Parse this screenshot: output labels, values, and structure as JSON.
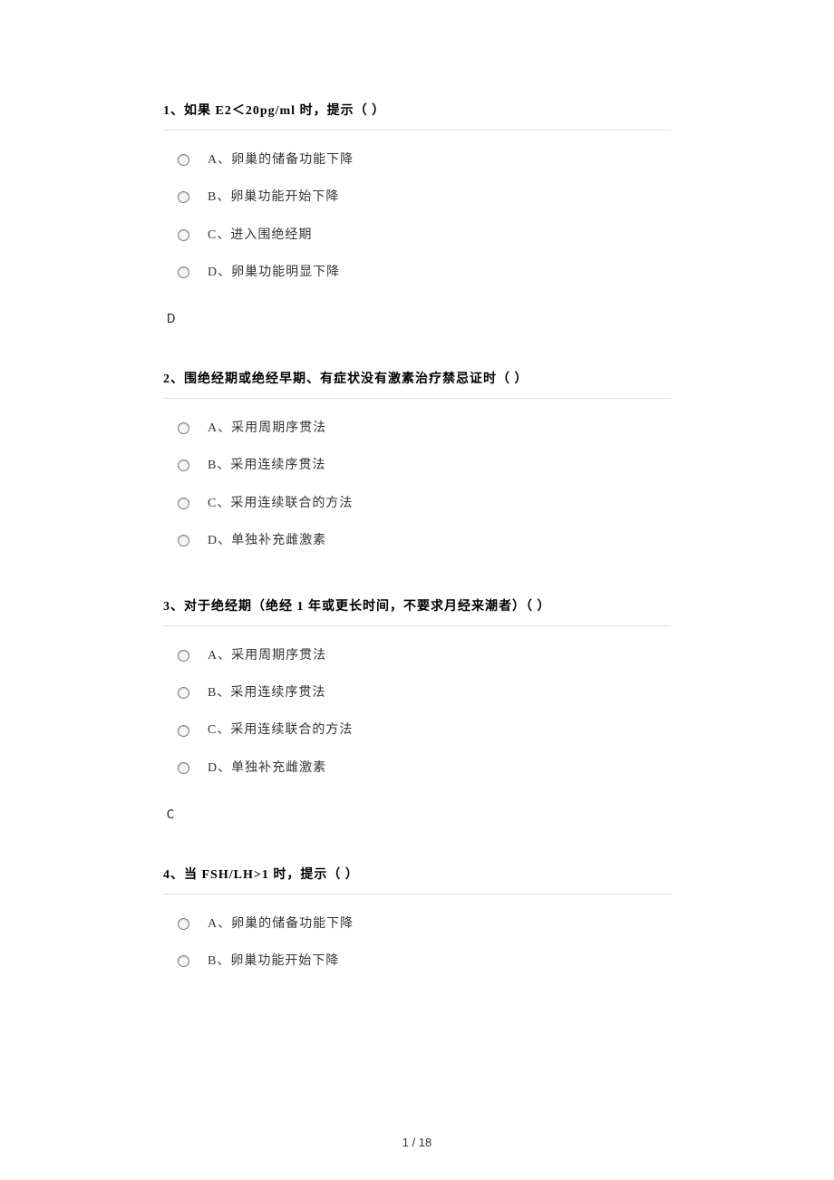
{
  "questions": [
    {
      "title": "1、如果 E2＜20pg/ml 时，提示（ ）",
      "options": [
        "A、卵巢的储备功能下降",
        "B、卵巢功能开始下降",
        "C、进入围绝经期",
        "D、卵巢功能明显下降"
      ],
      "answer": "D"
    },
    {
      "title": "2、围绝经期或绝经早期、有症状没有激素治疗禁忌证时（ ）",
      "options": [
        "A、采用周期序贯法",
        "B、采用连续序贯法",
        "C、采用连续联合的方法",
        "D、单独补充雌激素"
      ],
      "answer": ""
    },
    {
      "title": "3、对于绝经期（绝经 1 年或更长时间，不要求月经来潮者）（ ）",
      "options": [
        "A、采用周期序贯法",
        "B、采用连续序贯法",
        "C、采用连续联合的方法",
        "D、单独补充雌激素"
      ],
      "answer": "C"
    },
    {
      "title": "4、当 FSH/LH>1 时，提示（ ）",
      "options": [
        "A、卵巢的储备功能下降",
        "B、卵巢功能开始下降"
      ],
      "answer": ""
    }
  ],
  "footer": {
    "page": "1 / 18"
  }
}
